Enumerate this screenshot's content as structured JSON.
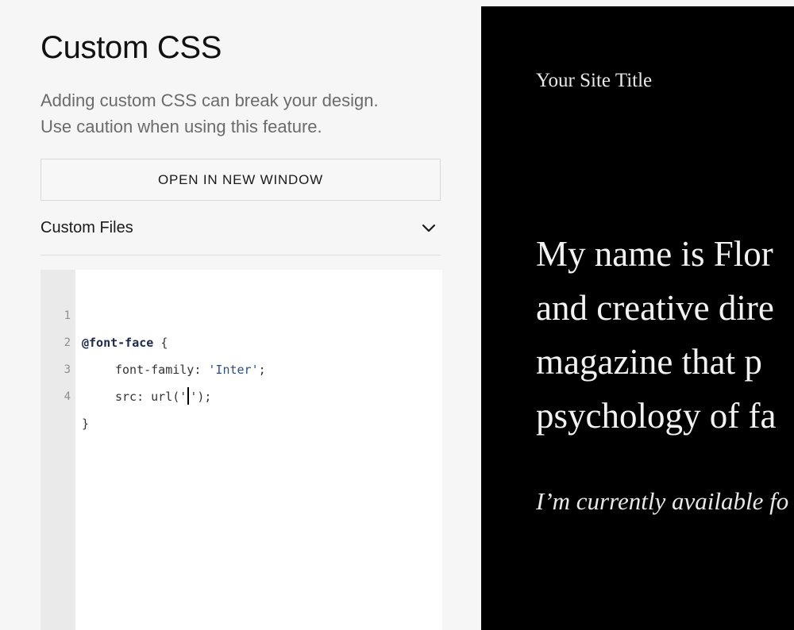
{
  "panel": {
    "title": "Custom CSS",
    "description_line1": "Adding custom CSS can break your design.",
    "description_line2": "Use caution when using this feature.",
    "open_button_label": "OPEN IN NEW WINDOW",
    "custom_files_label": "Custom Files",
    "custom_files_icon": "chevron-down-icon"
  },
  "editor": {
    "lines": [
      {
        "number": "1",
        "at_rule": "@font-face",
        "rest": " {"
      },
      {
        "number": "2",
        "property": "font-family: ",
        "value": "'Inter'",
        "end": ";"
      },
      {
        "number": "3",
        "before_caret": "src: url('",
        "after_caret": "');"
      },
      {
        "number": "4",
        "text": "}"
      }
    ]
  },
  "preview": {
    "site_title": "Your Site Title",
    "bio_lines": [
      "My name is Flor",
      "and creative dire",
      "magazine that p",
      "psychology of fa"
    ],
    "availability": "I’m currently available fo"
  },
  "colors": {
    "panel_background": "#f6f6f6",
    "preview_background": "#000000",
    "gutter": "#eaeaea"
  }
}
